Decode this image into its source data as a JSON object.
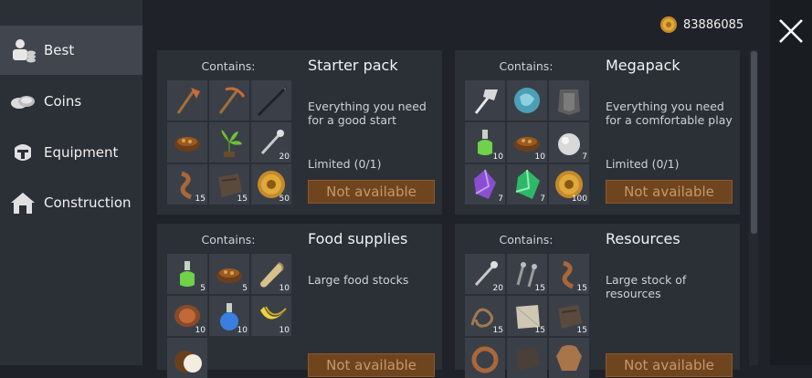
{
  "sidebar": {
    "items": [
      {
        "label": "Best",
        "icon": "best-icon"
      },
      {
        "label": "Coins",
        "icon": "coins-icon"
      },
      {
        "label": "Equipment",
        "icon": "equipment-icon"
      },
      {
        "label": "Construction",
        "icon": "construction-icon"
      }
    ]
  },
  "header": {
    "coins": "83886085"
  },
  "colors": {
    "accent_button": "#6f4520",
    "button_text": "#c69868",
    "panel": "#2b2f36",
    "cell": "#3b4048"
  },
  "packs": [
    {
      "title": "Starter pack",
      "contains_label": "Contains:",
      "description": "Everything you need for a good start",
      "limit": "Limited (0/1)",
      "button": "Not available",
      "items": [
        {
          "icon": "axe-icon",
          "qty": ""
        },
        {
          "icon": "pickaxe-icon",
          "qty": ""
        },
        {
          "icon": "spear-icon",
          "qty": ""
        },
        {
          "icon": "food-bowl-icon",
          "qty": ""
        },
        {
          "icon": "plant-icon",
          "qty": ""
        },
        {
          "icon": "nail-icon",
          "qty": "20"
        },
        {
          "icon": "rope-icon",
          "qty": "15"
        },
        {
          "icon": "leather-icon",
          "qty": "15"
        },
        {
          "icon": "coin-icon",
          "qty": "50"
        }
      ]
    },
    {
      "title": "Megapack",
      "contains_label": "Contains:",
      "description": "Everything you need for a comfortable play",
      "limit": "Limited (0/1)",
      "button": "Not available",
      "items": [
        {
          "icon": "cleaver-icon",
          "qty": ""
        },
        {
          "icon": "ice-rock-icon",
          "qty": ""
        },
        {
          "icon": "armor-icon",
          "qty": ""
        },
        {
          "icon": "potion-green-icon",
          "qty": "10"
        },
        {
          "icon": "food-bowl-icon",
          "qty": "10"
        },
        {
          "icon": "silver-orb-icon",
          "qty": "7"
        },
        {
          "icon": "purple-crystal-icon",
          "qty": "7"
        },
        {
          "icon": "green-crystal-icon",
          "qty": "7"
        },
        {
          "icon": "coin-icon",
          "qty": "100"
        }
      ]
    },
    {
      "title": "Food supplies",
      "contains_label": "Contains:",
      "description": "Large food stocks",
      "button": "Not available",
      "items": [
        {
          "icon": "potion-green-icon",
          "qty": "5"
        },
        {
          "icon": "food-bowl-icon",
          "qty": "5"
        },
        {
          "icon": "scroll-icon",
          "qty": "10"
        },
        {
          "icon": "meat-icon",
          "qty": "10"
        },
        {
          "icon": "potion-blue-icon",
          "qty": "10"
        },
        {
          "icon": "banana-icon",
          "qty": "10"
        },
        {
          "icon": "coconut-icon",
          "qty": ""
        }
      ]
    },
    {
      "title": "Resources",
      "contains_label": "Contains:",
      "description": "Large stock of resources",
      "button": "Not available",
      "items": [
        {
          "icon": "nail-icon",
          "qty": "20"
        },
        {
          "icon": "screws-icon",
          "qty": "15"
        },
        {
          "icon": "rope-icon",
          "qty": "15"
        },
        {
          "icon": "wire-icon",
          "qty": "15"
        },
        {
          "icon": "cloth-icon",
          "qty": "15"
        },
        {
          "icon": "leather-icon",
          "qty": "15"
        },
        {
          "icon": "rope-coil-icon",
          "qty": ""
        },
        {
          "icon": "leather-dark-icon",
          "qty": ""
        },
        {
          "icon": "hide-icon",
          "qty": ""
        }
      ]
    }
  ]
}
